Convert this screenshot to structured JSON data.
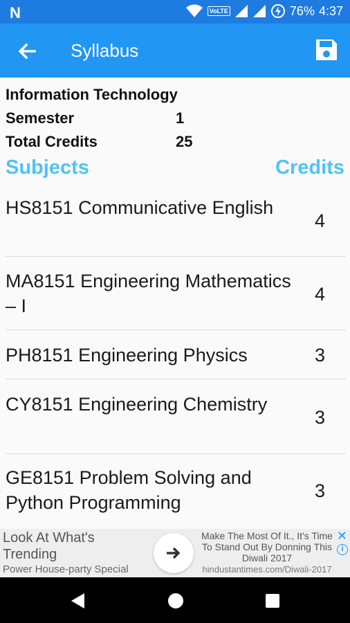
{
  "status_bar": {
    "carrier_icon": "n-logo-icon",
    "volte_label": "VoLTE",
    "battery_pct": "76%",
    "time": "4:37"
  },
  "app_bar": {
    "title": "Syllabus",
    "back_icon": "arrow-left-icon",
    "save_icon": "save-icon"
  },
  "course": {
    "department": "Information Technology",
    "semester_label": "Semester",
    "semester_value": "1",
    "credits_label": "Total Credits",
    "credits_value": "25"
  },
  "table": {
    "subjects_header": "Subjects",
    "credits_header": "Credits",
    "rows": [
      {
        "name": "HS8151 Communicative English",
        "credits": "4"
      },
      {
        "name": "MA8151 Engineering Mathematics – I",
        "credits": "4"
      },
      {
        "name": "PH8151 Engineering Physics",
        "credits": "3"
      },
      {
        "name": "CY8151 Engineering Chemistry",
        "credits": "3"
      },
      {
        "name": "GE8151 Problem Solving and Python Programming",
        "credits": "3"
      }
    ]
  },
  "ad": {
    "headline_1": "Look At What's",
    "headline_2": "Trending",
    "subline": "Power House-party Special",
    "right_text": "Make The Most Of It., It's Time To Stand Out By Donning This Diwali 2017",
    "url": "hindustantimes.com/Diwali-2017",
    "close_symbol": "✕",
    "info_symbol": "i"
  },
  "colors": {
    "status_bar": "#1e7be0",
    "app_bar": "#2196f3",
    "header_accent": "#4fc3f7"
  }
}
